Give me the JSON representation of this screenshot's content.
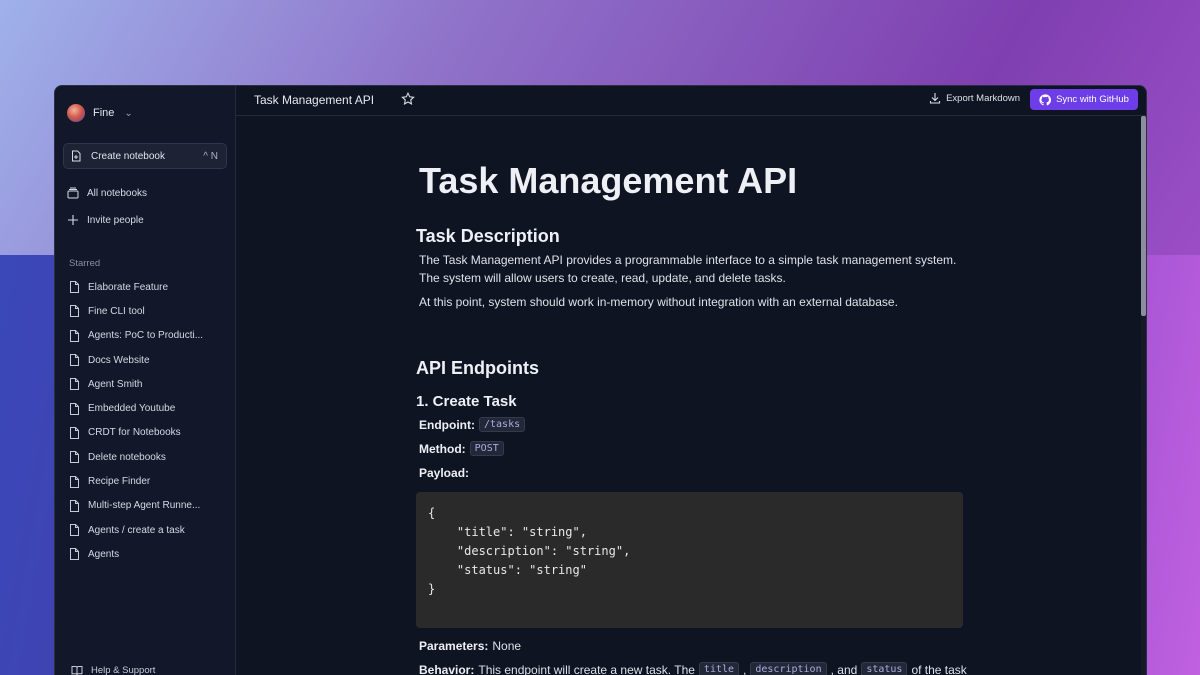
{
  "sidebar": {
    "workspace": "Fine",
    "create_label": "Create notebook",
    "create_shortcut": "^ N",
    "nav": [
      {
        "label": "All notebooks",
        "icon": "stack-icon"
      },
      {
        "label": "Invite people",
        "icon": "plus-icon"
      }
    ],
    "section": "Starred",
    "pages": [
      "Elaborate Feature",
      "Fine CLI tool",
      "Agents: PoC to Producti...",
      "Docs Website",
      "Agent Smith",
      "Embedded Youtube",
      "CRDT for Notebooks",
      "Delete notebooks",
      "Recipe Finder",
      "Multi-step Agent Runne...",
      "Agents / create a task",
      "Agents"
    ],
    "help": "Help & Support"
  },
  "topbar": {
    "title": "Task Management API",
    "export_label": "Export Markdown",
    "sync_label": "Sync with GitHub"
  },
  "doc": {
    "h1": "Task Management API",
    "desc_heading": "Task Description",
    "desc_p1": "The Task Management API provides a programmable interface to a simple task management system. The system will allow users to create, read, update, and delete tasks.",
    "desc_p2": "At this point, system should work in-memory without integration with an external database.",
    "endpoints_heading": "API Endpoints",
    "create_heading": "1. Create Task",
    "endpoint_label": "Endpoint:",
    "endpoint_value": "/tasks",
    "method_label": "Method:",
    "method_value": "POST",
    "payload_label": "Payload:",
    "payload_code": "{\n    \"title\": \"string\",\n    \"description\": \"string\",\n    \"status\": \"string\"\n}",
    "params_label": "Parameters:",
    "params_value": "None",
    "behavior_label": "Behavior:",
    "behavior_text": "This endpoint will create a new task. The",
    "behavior_code1": "title",
    "behavior_code2": "description",
    "behavior_and": ", and",
    "behavior_code3": "status",
    "behavior_tail": "of the task"
  },
  "colors": {
    "accent": "#6d3ee8",
    "window_bg": "#0f1422",
    "sidebar_bg": "#12172a"
  }
}
